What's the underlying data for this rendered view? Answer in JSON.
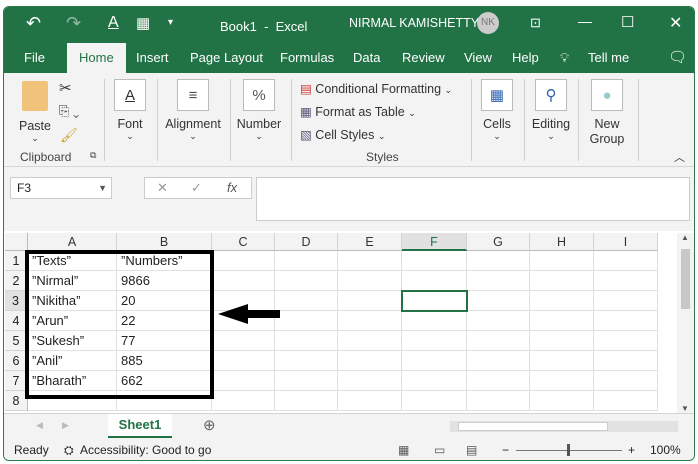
{
  "title_bar": {
    "doc_title": "Book1  -  Excel",
    "user_name": "NIRMAL KAMISHETTY",
    "avatar_initials": "NK"
  },
  "tabs": [
    {
      "label": "File"
    },
    {
      "label": "Home",
      "active": true
    },
    {
      "label": "Insert"
    },
    {
      "label": "Page Layout"
    },
    {
      "label": "Formulas"
    },
    {
      "label": "Data"
    },
    {
      "label": "Review"
    },
    {
      "label": "View"
    },
    {
      "label": "Help"
    },
    {
      "label": "Tell me"
    }
  ],
  "ribbon": {
    "paste": "Paste",
    "clipboard": "Clipboard",
    "font": "Font",
    "alignment": "Alignment",
    "number": "Number",
    "conditional_formatting": "Conditional Formatting",
    "format_as_table": "Format as Table",
    "cell_styles": "Cell Styles",
    "styles": "Styles",
    "cells": "Cells",
    "editing": "Editing",
    "new_group": "New Group"
  },
  "formula_bar": {
    "name_box": "F3",
    "formula": ""
  },
  "columns": [
    "A",
    "B",
    "C",
    "D",
    "E",
    "F",
    "G",
    "H",
    "I"
  ],
  "rows": [
    "1",
    "2",
    "3",
    "4",
    "5",
    "6",
    "7",
    "8"
  ],
  "cells": [
    [
      "”Texts”",
      "”Numbers”"
    ],
    [
      "”Nirmal”",
      "9866"
    ],
    [
      "”Nikitha”",
      "20"
    ],
    [
      "”Arun”",
      "22"
    ],
    [
      "”Sukesh”",
      "77"
    ],
    [
      "”Anil”",
      "885"
    ],
    [
      "”Bharath”",
      "662"
    ]
  ],
  "selected_cell": "F3",
  "sheet_tab": "Sheet1",
  "status": {
    "ready": "Ready",
    "accessibility": "Accessibility: Good to go",
    "zoom": "100%"
  },
  "colors": {
    "accent": "#217346"
  }
}
